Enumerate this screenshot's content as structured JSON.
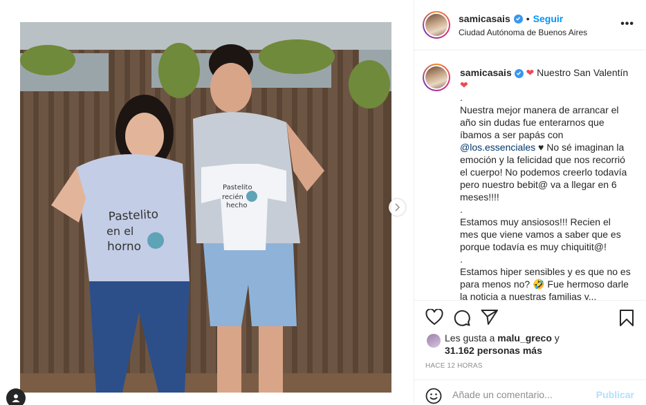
{
  "post": {
    "image_alt": "Foto de pareja con camisetas Pastelito en el horno y body Pastelito recién hecho",
    "shirt_text": "Pastelito en el horno",
    "onesie_text": "Pastelito recién hecho"
  },
  "header": {
    "username": "samicasais",
    "separator": "•",
    "follow_label": "Seguir",
    "location": "Ciudad Autónoma de Buenos Aires",
    "more_label": "•••"
  },
  "caption": {
    "username": "samicasais",
    "heart1": "❤",
    "title": " Nuestro San Valentín",
    "heart2": "❤",
    "p1": ".\nNuestra mejor manera de arrancar el año sin dudas fue enterarnos que íbamos a ser papás con ",
    "mention": "@los.essenciales",
    "p1b": " ♥ No sé imaginan la emoción y la felicidad que nos recorrió el cuerpo! No podemos creerlo todavía pero nuestro bebit@ va a llegar en 6 meses!!!!\n.\nEstamos muy ansiosos!!! Recien el mes que viene vamos a saber que es porque todavía es muy chiquitit@!\n.\nEstamos hiper sensibles y es que no es para menos no? 🤣 Fue hermoso darle la noticia a nuestras familias y..."
  },
  "likes": {
    "prefix": "Les gusta a ",
    "user": "malu_greco",
    "suffix": " y",
    "count": "31.162 personas más"
  },
  "time": "HACE 12 HORAS",
  "comment": {
    "placeholder": "Añade un comentario...",
    "publish_label": "Publicar"
  },
  "colors": {
    "accent": "#0095f6",
    "verified": "#3897f0",
    "heart": "#ed4956",
    "publish_disabled": "#b2dffc"
  }
}
